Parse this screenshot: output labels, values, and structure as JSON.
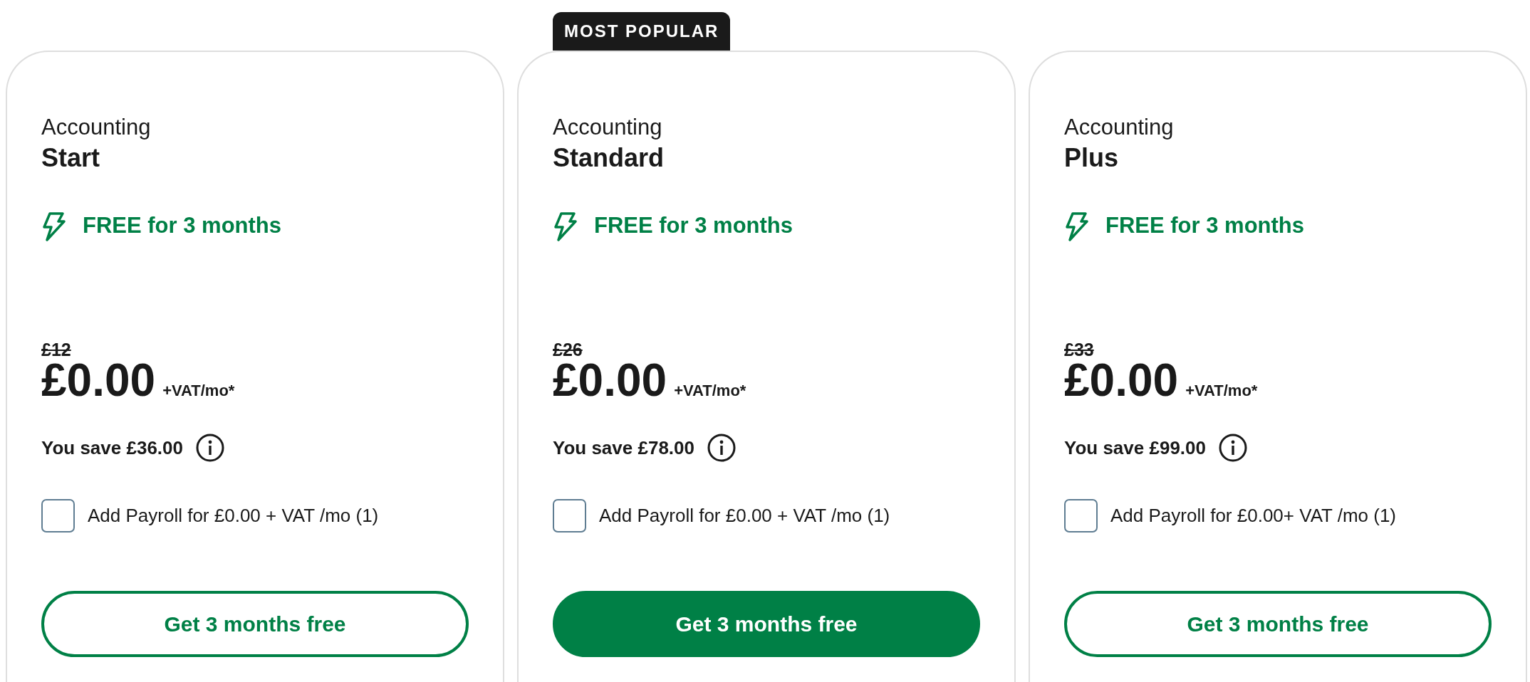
{
  "plans": [
    {
      "category": "Accounting",
      "name": "Start",
      "offer": "FREE for 3 months",
      "old_price": "£12",
      "price": "£0.00",
      "price_suffix": "+VAT/mo*",
      "savings": "You save £36.00",
      "addon": {
        "label": "Add Payroll for £0.00 + VAT /mo (1)",
        "checked": false
      },
      "button": {
        "label": "Get 3 months free",
        "primary": false
      }
    },
    {
      "category": "Accounting",
      "name": "Standard",
      "badge": "MOST POPULAR",
      "offer": "FREE for 3 months",
      "old_price": "£26",
      "price": "£0.00",
      "price_suffix": "+VAT/mo*",
      "savings": "You save £78.00",
      "addon": {
        "label": "Add Payroll for £0.00 + VAT /mo (1)",
        "checked": false
      },
      "button": {
        "label": "Get 3 months free",
        "primary": true
      }
    },
    {
      "category": "Accounting",
      "name": "Plus",
      "offer": "FREE for 3 months",
      "old_price": "£33",
      "price": "£0.00",
      "price_suffix": "+VAT/mo*",
      "savings": "You save £99.00",
      "addon": {
        "label": "Add Payroll for £0.00+ VAT /mo (1)",
        "checked": false
      },
      "button": {
        "label": "Get 3 months free",
        "primary": false
      }
    }
  ]
}
